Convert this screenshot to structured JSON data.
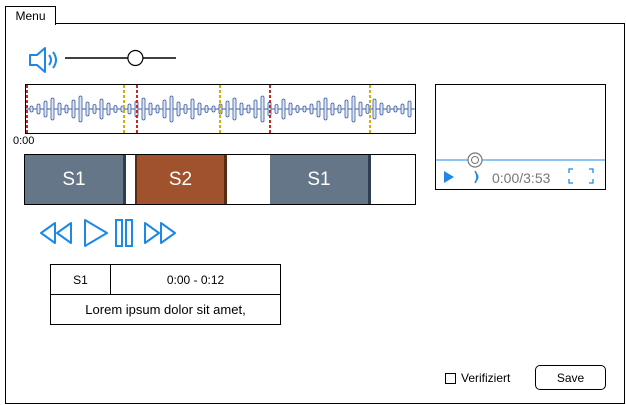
{
  "menu": {
    "label": "Menu"
  },
  "audio": {
    "volume_level": 0.65,
    "waveform_start_time": "0:00"
  },
  "segments": [
    {
      "label": "S1",
      "color": "#647687"
    },
    {
      "label": "S2",
      "color": "#A0522D"
    },
    {
      "label": "S1",
      "color": "#647687"
    }
  ],
  "video": {
    "time": "0:00/3:53",
    "progress": 0.0
  },
  "transport": {
    "icons": [
      "rewind-icon",
      "play-icon",
      "pause-icon",
      "fast-forward-icon"
    ]
  },
  "segment_table": {
    "speaker": "S1",
    "range": "0:00 - 0:12",
    "text": "Lorem ipsum dolor sit amet,"
  },
  "footer": {
    "verify_label": "Verifiziert",
    "save_label": "Save"
  },
  "colors": {
    "accent": "#1E88E5",
    "wave": "#3A5BA0",
    "marker_red": "#C62828",
    "marker_yellow": "#D4B000"
  }
}
